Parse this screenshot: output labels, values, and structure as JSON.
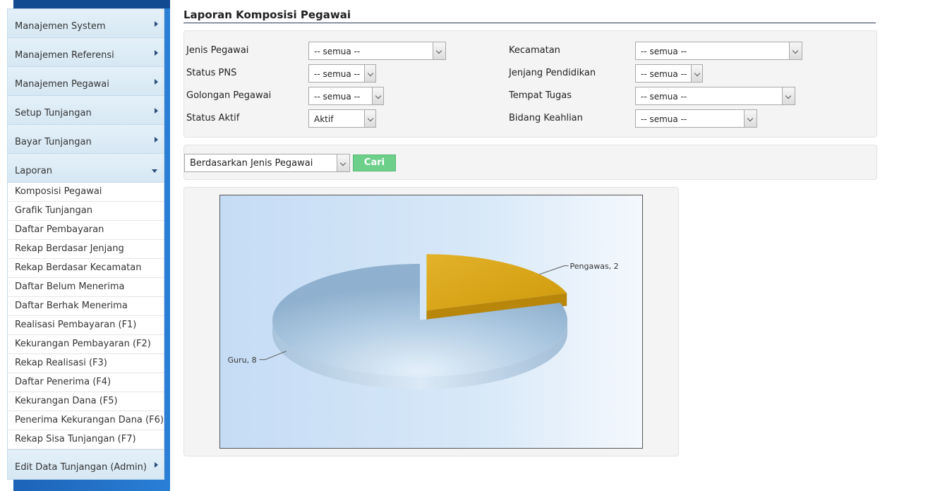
{
  "sidebar": {
    "menus": [
      {
        "label": "Manajemen System"
      },
      {
        "label": "Manajemen Referensi"
      },
      {
        "label": "Manajemen Pegawai"
      },
      {
        "label": "Setup Tunjangan"
      },
      {
        "label": "Bayar Tunjangan"
      },
      {
        "label": "Laporan"
      }
    ],
    "laporan_items": [
      "Komposisi Pegawai",
      "Grafik Tunjangan",
      "Daftar Pembayaran",
      "Rekap Berdasar Jenjang",
      "Rekap Berdasar Kecamatan",
      "Daftar Belum Menerima",
      "Daftar Berhak Menerima",
      "Realisasi Pembayaran (F1)",
      "Kekurangan Pembayaran (F2)",
      "Rekap Realisasi (F3)",
      "Daftar Penerima (F4)",
      "Kekurangan Dana (F5)",
      "Penerima Kekurangan Dana (F6)",
      "Rekap Sisa Tunjangan (F7)"
    ],
    "last_menu": "Edit Data Tunjangan (Admin)"
  },
  "page": {
    "title": "Laporan Komposisi Pegawai"
  },
  "filters": {
    "jenis_pegawai": {
      "label": "Jenis Pegawai",
      "value": "-- semua --"
    },
    "status_pns": {
      "label": "Status PNS",
      "value": "-- semua --"
    },
    "golongan_pegawai": {
      "label": "Golongan Pegawai",
      "value": "-- semua --"
    },
    "status_aktif": {
      "label": "Status Aktif",
      "value": "Aktif"
    },
    "kecamatan": {
      "label": "Kecamatan",
      "value": "-- semua --"
    },
    "jenjang_pendidikan": {
      "label": "Jenjang Pendidikan",
      "value": "-- semua --"
    },
    "tempat_tugas": {
      "label": "Tempat Tugas",
      "value": "-- semua --"
    },
    "bidang_keahlian": {
      "label": "Bidang Keahlian",
      "value": "-- semua --"
    }
  },
  "grouping": {
    "value": "Berdasarkan Jenis Pegawai",
    "button_label": "Cari"
  },
  "chart_data": {
    "type": "pie",
    "title": "",
    "categories": [
      "Guru",
      "Pengawas"
    ],
    "values": [
      8,
      2
    ],
    "labels": [
      "Guru, 8",
      "Pengawas, 2"
    ],
    "colors": [
      "#9dbcd8",
      "#d4a00e"
    ],
    "three_d": true
  }
}
